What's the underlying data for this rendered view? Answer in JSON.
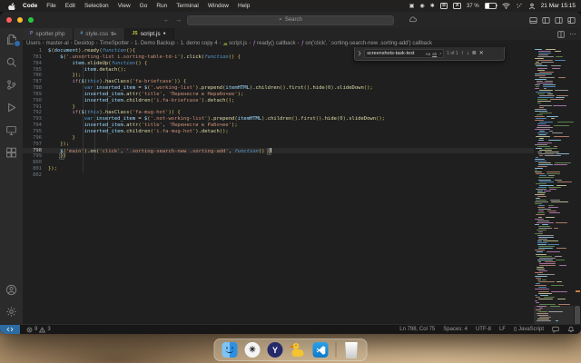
{
  "menu_bar": {
    "items": [
      "Code",
      "File",
      "Edit",
      "Selection",
      "View",
      "Go",
      "Run",
      "Terminal",
      "Window",
      "Help"
    ],
    "status_icons": [
      {
        "name": "shield-app-icon",
        "glyph": "▣",
        "boxed": false
      },
      {
        "name": "circle-app-icon",
        "glyph": "◉",
        "boxed": false
      },
      {
        "name": "gear-app-icon",
        "glyph": "✱",
        "boxed": false
      },
      {
        "name": "boxed-b-app-icon",
        "glyph": "B",
        "boxed": true
      },
      {
        "name": "input-source-icon",
        "glyph": "A",
        "boxed": true
      }
    ],
    "battery_label": "37 %",
    "clock": "21 Mar 15:15"
  },
  "window": {
    "search_label": "Search",
    "tabs": [
      {
        "label": "spotter.php",
        "icon": "P",
        "icon_color": "#a074c4",
        "active": false,
        "badge": "",
        "modified": false
      },
      {
        "label": "style.css",
        "icon": "#",
        "icon_color": "#519aba",
        "active": false,
        "badge": "9+",
        "modified": false
      },
      {
        "label": "script.js",
        "icon": "JS",
        "icon_color": "#cbcb41",
        "active": true,
        "badge": "",
        "modified": true
      }
    ],
    "breadcrumbs": [
      {
        "label": "Users",
        "icon": ""
      },
      {
        "label": "master-al",
        "icon": ""
      },
      {
        "label": "Desktop",
        "icon": ""
      },
      {
        "label": "TimeSpotter",
        "icon": ""
      },
      {
        "label": "1. Demo Backup",
        "icon": ""
      },
      {
        "label": "1. demo copy 4",
        "icon": ""
      },
      {
        "label": "script.js",
        "icon": "js"
      },
      {
        "label": "ready() callback",
        "icon": "fn"
      },
      {
        "label": "on('click', '.sorting-search-new .sorting-add') callback",
        "icon": "fn"
      }
    ],
    "find": {
      "query": "screenshots-task-text",
      "toggles": [
        "Aa",
        "ab",
        ".*"
      ],
      "count": "1 of 1"
    }
  },
  "editor": {
    "lines": [
      {
        "n": "1",
        "t": [
          [
            "v",
            "$"
          ],
          [
            "g",
            "("
          ],
          [
            "v",
            "document"
          ],
          [
            "g",
            ")"
          ],
          [
            "p",
            "."
          ],
          [
            "f",
            "ready"
          ],
          [
            "g",
            "("
          ],
          [
            "i",
            "function"
          ],
          [
            "g",
            "(){"
          ]
        ]
      },
      {
        "n": "781",
        "t": [
          [
            "p",
            "    "
          ],
          [
            "v",
            "$"
          ],
          [
            "g",
            "("
          ],
          [
            "s",
            "'.unsorting-list i.sorting-table-td-i'"
          ],
          [
            "g",
            ")"
          ],
          [
            "p",
            "."
          ],
          [
            "f",
            "click"
          ],
          [
            "g",
            "("
          ],
          [
            "i",
            "function"
          ],
          [
            "g",
            "() {"
          ]
        ]
      },
      {
        "n": "784",
        "t": [
          [
            "p",
            "        "
          ],
          [
            "v",
            "item"
          ],
          [
            "p",
            "."
          ],
          [
            "f",
            "slideUp"
          ],
          [
            "g",
            "("
          ],
          [
            "i",
            "function"
          ],
          [
            "g",
            "() {"
          ]
        ]
      },
      {
        "n": "785",
        "t": [
          [
            "p",
            "            "
          ],
          [
            "v",
            "item"
          ],
          [
            "p",
            "."
          ],
          [
            "f",
            "detach"
          ],
          [
            "g",
            "();"
          ]
        ]
      },
      {
        "n": "786",
        "t": [
          [
            "p",
            "        "
          ],
          [
            "g",
            "});"
          ]
        ]
      },
      {
        "n": "787",
        "t": [
          [
            "p",
            "        "
          ],
          [
            "c",
            "if"
          ],
          [
            "g",
            "("
          ],
          [
            "v",
            "$"
          ],
          [
            "g",
            "("
          ],
          [
            "i",
            "this"
          ],
          [
            "g",
            ")"
          ],
          [
            "p",
            "."
          ],
          [
            "f",
            "hasClass"
          ],
          [
            "g",
            "("
          ],
          [
            "s",
            "'fa-briefcase'"
          ],
          [
            "g",
            ")) {"
          ]
        ]
      },
      {
        "n": "788",
        "t": [
          [
            "p",
            "            "
          ],
          [
            "k",
            "var"
          ],
          [
            "p",
            " "
          ],
          [
            "v",
            "inserted_item"
          ],
          [
            "p",
            " = "
          ],
          [
            "v",
            "$"
          ],
          [
            "g",
            "("
          ],
          [
            "s",
            "'.working-list'"
          ],
          [
            "g",
            ")"
          ],
          [
            "p",
            "."
          ],
          [
            "f",
            "prepend"
          ],
          [
            "g",
            "("
          ],
          [
            "v",
            "itemHTML"
          ],
          [
            "g",
            ")"
          ],
          [
            "p",
            "."
          ],
          [
            "f",
            "children"
          ],
          [
            "g",
            "()"
          ],
          [
            "p",
            "."
          ],
          [
            "f",
            "first"
          ],
          [
            "g",
            "()"
          ],
          [
            "p",
            "."
          ],
          [
            "f",
            "hide"
          ],
          [
            "g",
            "("
          ],
          [
            "d",
            "0"
          ],
          [
            "g",
            ")"
          ],
          [
            "p",
            "."
          ],
          [
            "f",
            "slideDown"
          ],
          [
            "g",
            "();"
          ]
        ]
      },
      {
        "n": "789",
        "t": [
          [
            "p",
            "            "
          ],
          [
            "v",
            "inserted_item"
          ],
          [
            "p",
            "."
          ],
          [
            "f",
            "attr"
          ],
          [
            "g",
            "("
          ],
          [
            "s",
            "'title'"
          ],
          [
            "p",
            ", "
          ],
          [
            "s",
            "'Перенести в Нерабочее'"
          ],
          [
            "g",
            ");"
          ]
        ]
      },
      {
        "n": "790",
        "t": [
          [
            "p",
            "            "
          ],
          [
            "v",
            "inserted_item"
          ],
          [
            "p",
            "."
          ],
          [
            "f",
            "children"
          ],
          [
            "g",
            "("
          ],
          [
            "s",
            "'i.fa-briefcase'"
          ],
          [
            "g",
            ")"
          ],
          [
            "p",
            "."
          ],
          [
            "f",
            "detach"
          ],
          [
            "g",
            "();"
          ]
        ]
      },
      {
        "n": "791",
        "t": [
          [
            "p",
            "        "
          ],
          [
            "g",
            "}"
          ]
        ]
      },
      {
        "n": "792",
        "t": [
          [
            "p",
            "        "
          ],
          [
            "c",
            "if"
          ],
          [
            "g",
            "("
          ],
          [
            "v",
            "$"
          ],
          [
            "g",
            "("
          ],
          [
            "i",
            "this"
          ],
          [
            "g",
            ")"
          ],
          [
            "p",
            "."
          ],
          [
            "f",
            "hasClass"
          ],
          [
            "g",
            "("
          ],
          [
            "s",
            "'fa-mug-hot'"
          ],
          [
            "g",
            ")) {"
          ]
        ]
      },
      {
        "n": "793",
        "t": [
          [
            "p",
            "            "
          ],
          [
            "k",
            "var"
          ],
          [
            "p",
            " "
          ],
          [
            "v",
            "inserted_item"
          ],
          [
            "p",
            " = "
          ],
          [
            "v",
            "$"
          ],
          [
            "g",
            "("
          ],
          [
            "s",
            "'.not-working-list'"
          ],
          [
            "g",
            ")"
          ],
          [
            "p",
            "."
          ],
          [
            "f",
            "prepend"
          ],
          [
            "g",
            "("
          ],
          [
            "v",
            "itemHTML"
          ],
          [
            "g",
            ")"
          ],
          [
            "p",
            "."
          ],
          [
            "f",
            "children"
          ],
          [
            "g",
            "()"
          ],
          [
            "p",
            "."
          ],
          [
            "f",
            "first"
          ],
          [
            "g",
            "()"
          ],
          [
            "p",
            "."
          ],
          [
            "f",
            "hide"
          ],
          [
            "g",
            "("
          ],
          [
            "d",
            "0"
          ],
          [
            "g",
            ")"
          ],
          [
            "p",
            "."
          ],
          [
            "f",
            "slideDown"
          ],
          [
            "g",
            "();"
          ]
        ]
      },
      {
        "n": "794",
        "t": [
          [
            "p",
            "            "
          ],
          [
            "v",
            "inserted_item"
          ],
          [
            "p",
            "."
          ],
          [
            "f",
            "attr"
          ],
          [
            "g",
            "("
          ],
          [
            "s",
            "'title'"
          ],
          [
            "p",
            ", "
          ],
          [
            "s",
            "'Перенести в Рабочее'"
          ],
          [
            "g",
            ");"
          ]
        ]
      },
      {
        "n": "795",
        "t": [
          [
            "p",
            "            "
          ],
          [
            "v",
            "inserted_item"
          ],
          [
            "p",
            "."
          ],
          [
            "f",
            "children"
          ],
          [
            "g",
            "("
          ],
          [
            "s",
            "'i.fa-mug-hot'"
          ],
          [
            "g",
            ")"
          ],
          [
            "p",
            "."
          ],
          [
            "f",
            "detach"
          ],
          [
            "g",
            "();"
          ]
        ]
      },
      {
        "n": "796",
        "t": [
          [
            "p",
            "        "
          ],
          [
            "g",
            "}"
          ]
        ]
      },
      {
        "n": "797",
        "t": [
          [
            "p",
            "    "
          ],
          [
            "g",
            "});"
          ]
        ]
      },
      {
        "n": "798",
        "cur": true,
        "caret": true,
        "t": [
          [
            "p",
            "    "
          ],
          [
            "v",
            "$"
          ],
          [
            "g",
            "("
          ],
          [
            "s",
            "'main'"
          ],
          [
            "g",
            ")"
          ],
          [
            "p",
            "."
          ],
          [
            "f",
            "on"
          ],
          [
            "g",
            "("
          ],
          [
            "s",
            "'click'"
          ],
          [
            "p",
            ", "
          ],
          [
            "s",
            "'.sorting-search-new .sorting-add'"
          ],
          [
            "p",
            ", "
          ],
          [
            "i",
            "function"
          ],
          [
            "g",
            "() "
          ],
          [
            "b",
            "{"
          ]
        ]
      },
      {
        "n": "799",
        "t": [
          [
            "p",
            "    "
          ],
          [
            "b",
            "}"
          ],
          [
            "g",
            ")"
          ]
        ]
      },
      {
        "n": "800",
        "t": []
      },
      {
        "n": "801",
        "t": [
          [
            "g",
            "});"
          ]
        ]
      },
      {
        "n": "802",
        "t": []
      }
    ]
  },
  "activity_bar": {
    "top": [
      {
        "name": "explorer",
        "badge": true
      },
      {
        "name": "search",
        "badge": false
      },
      {
        "name": "source-control",
        "badge": false
      },
      {
        "name": "run-debug",
        "badge": false
      },
      {
        "name": "remote-explorer",
        "badge": false
      },
      {
        "name": "extensions",
        "badge": false
      }
    ],
    "bottom": [
      {
        "name": "account",
        "badge": false
      },
      {
        "name": "settings",
        "badge": false
      }
    ]
  },
  "status_bar": {
    "errors": "9",
    "warnings": "3",
    "line_col": "Ln 798, Col 75",
    "spaces": "Spaces: 4",
    "encoding": "UTF-8",
    "eol": "LF",
    "language": "JavaScript"
  },
  "dock": {
    "items": [
      "finder",
      "chatgpt",
      "y-browser",
      "cyberduck",
      "vscode",
      "trash"
    ]
  }
}
